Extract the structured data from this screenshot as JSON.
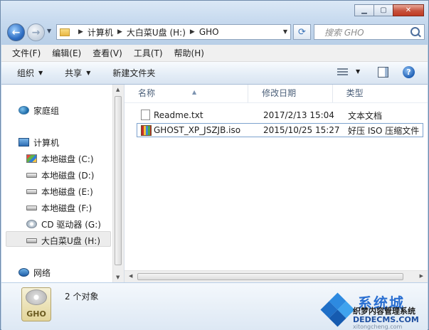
{
  "window": {
    "caption_buttons": [
      "minimize",
      "maximize",
      "close"
    ]
  },
  "address_bar": {
    "breadcrumbs": [
      "计算机",
      "大白菜U盘 (H:)",
      "GHO"
    ]
  },
  "search": {
    "placeholder": "搜索 GHO"
  },
  "menubar": {
    "items": [
      "文件(F)",
      "编辑(E)",
      "查看(V)",
      "工具(T)",
      "帮助(H)"
    ]
  },
  "toolbar": {
    "organize_label": "组织",
    "share_label": "共享",
    "new_folder_label": "新建文件夹",
    "help_glyph": "?"
  },
  "nav": {
    "items": [
      {
        "label": "家庭组",
        "icon": "homegroup-icon"
      },
      {
        "label": "计算机",
        "icon": "computer-icon"
      },
      {
        "label": "本地磁盘 (C:)",
        "icon": "system-drive-icon"
      },
      {
        "label": "本地磁盘 (D:)",
        "icon": "drive-icon"
      },
      {
        "label": "本地磁盘 (E:)",
        "icon": "drive-icon"
      },
      {
        "label": "本地磁盘 (F:)",
        "icon": "drive-icon"
      },
      {
        "label": "CD 驱动器 (G:)",
        "icon": "cd-drive-icon"
      },
      {
        "label": "大白菜U盘 (H:)",
        "icon": "usb-drive-icon",
        "selected": true
      },
      {
        "label": "网络",
        "icon": "network-icon"
      }
    ]
  },
  "columns": {
    "name": "名称",
    "modified": "修改日期",
    "type": "类型"
  },
  "files": [
    {
      "name": "Readme.txt",
      "modified": "2017/2/13 15:04",
      "type": "文本文档",
      "icon": "text-file-icon"
    },
    {
      "name": "GHOST_XP_JSZJB.iso",
      "modified": "2015/10/25 15:27",
      "type": "好压 ISO 压缩文件",
      "icon": "iso-archive-icon",
      "selected": true
    }
  ],
  "details": {
    "icon_label": "GHO",
    "count_text": "2 个对象"
  },
  "watermark": {
    "brand": "系统城",
    "subtitle": "织梦内容管理系统",
    "url": "DEDECMS.COM",
    "url2": "xitongcheng.com"
  }
}
